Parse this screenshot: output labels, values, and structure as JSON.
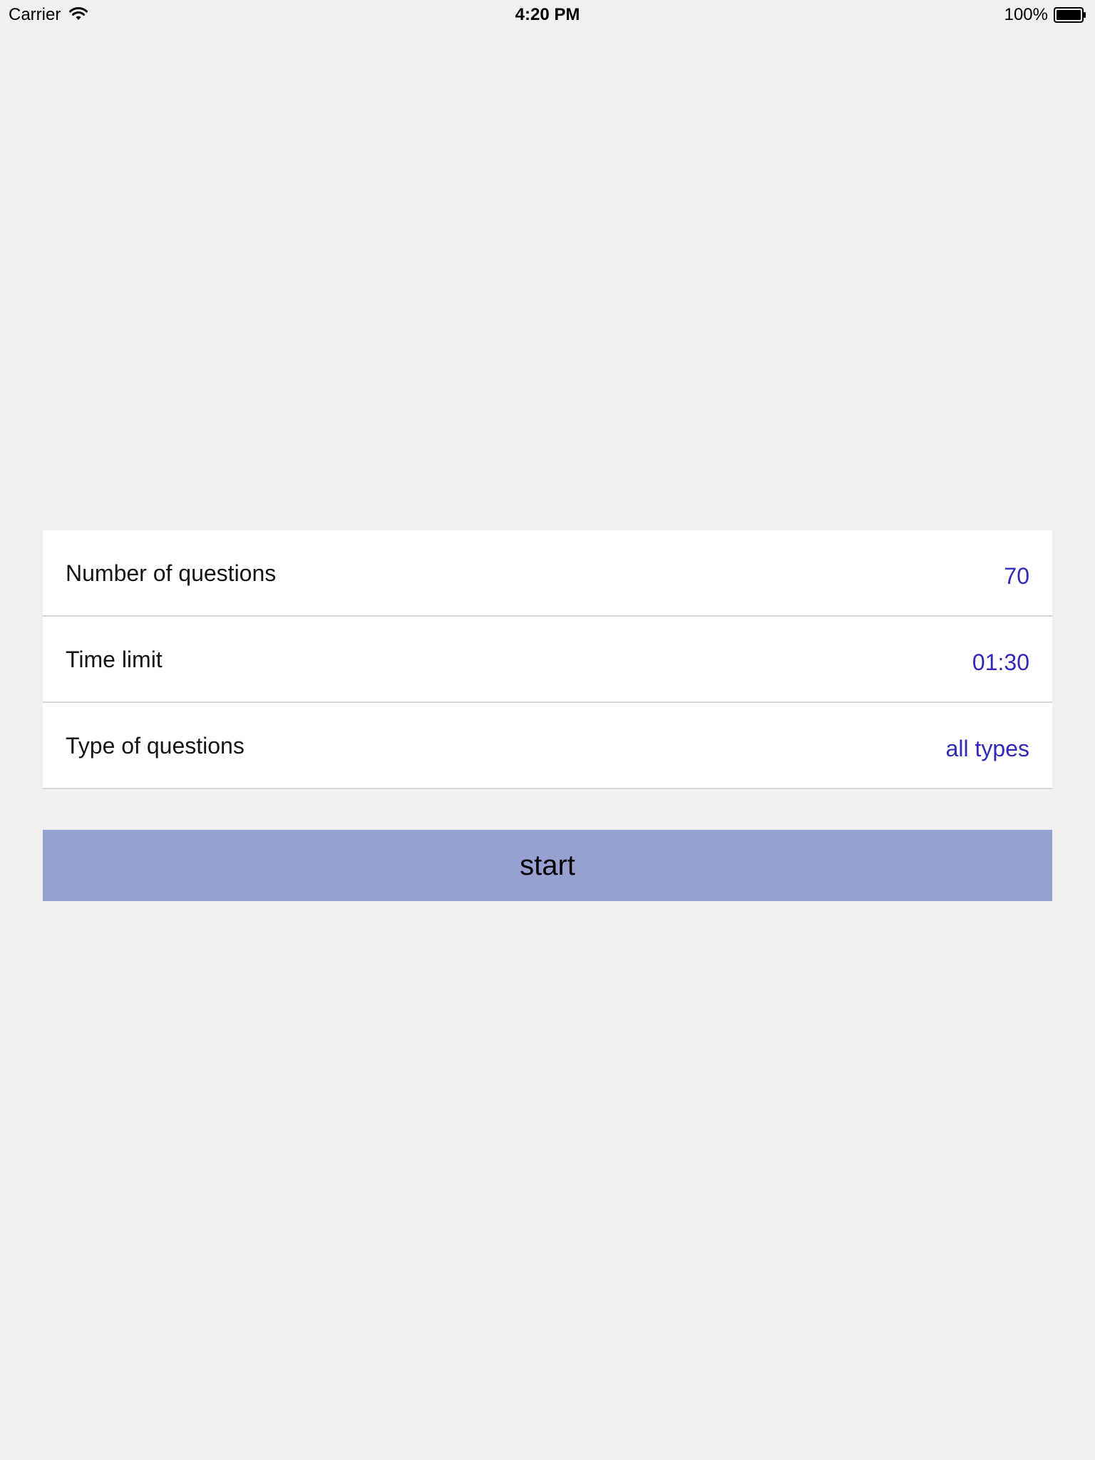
{
  "status_bar": {
    "carrier": "Carrier",
    "time": "4:20 PM",
    "battery_percent": "100%",
    "wifi_icon": "wifi-icon",
    "battery_icon": "battery-icon"
  },
  "settings": {
    "rows": [
      {
        "label": "Number of questions",
        "value": "70"
      },
      {
        "label": "Time limit",
        "value": "01:30"
      },
      {
        "label": "Type of questions",
        "value": "all types"
      }
    ]
  },
  "start_button": {
    "label": "start"
  },
  "colors": {
    "background": "#f0f0f0",
    "value_text": "#3329b8",
    "button_background": "#97a1d1"
  }
}
